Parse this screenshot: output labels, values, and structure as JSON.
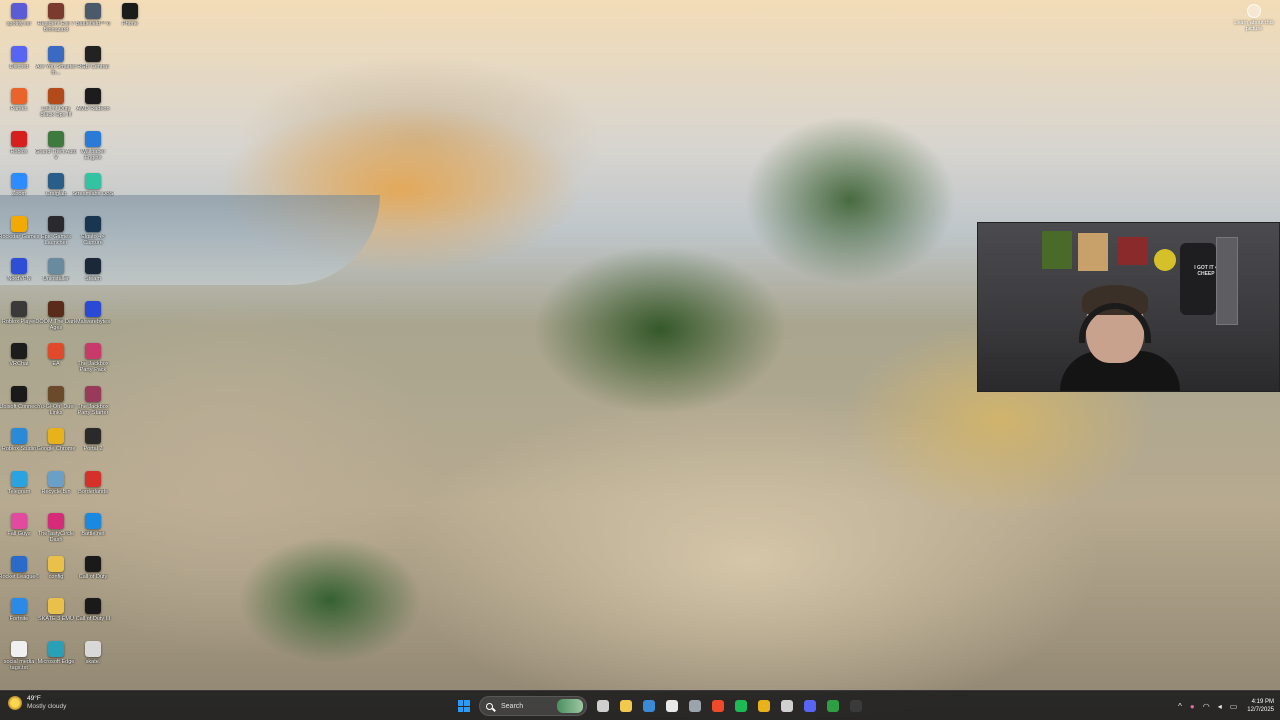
{
  "desktop": {
    "icons": [
      {
        "label": "spotify.ver",
        "icon": "spotify-icon",
        "color": "#5b5bd6"
      },
      {
        "label": "Resident Evil 7 Biohazard",
        "icon": "resident-evil-icon",
        "color": "#7a3b2e"
      },
      {
        "label": "Battlefield™ 6",
        "icon": "battlefield-icon",
        "color": "#4a5a6a"
      },
      {
        "label": "Phone",
        "icon": "phone-icon",
        "color": "#1b1b1b"
      },
      {
        "label": "Discord",
        "icon": "discord-icon",
        "color": "#5865f2"
      },
      {
        "label": "Are You Smarter th...",
        "icon": "game-icon",
        "color": "#3a6ac2"
      },
      {
        "label": "RGB Central",
        "icon": "rgb-icon",
        "color": "#222222"
      },
      {
        "label": "Parsec",
        "icon": "parsec-icon",
        "color": "#e9642b"
      },
      {
        "label": "Call of Duty Black Ops III",
        "icon": "cod-icon",
        "color": "#b34a1a"
      },
      {
        "label": "AMD Radeon",
        "icon": "amd-icon",
        "color": "#1c1c1c"
      },
      {
        "label": "Roblox",
        "icon": "roblox-icon",
        "color": "#d62020"
      },
      {
        "label": "Grand Theft Auto V",
        "icon": "gta-icon",
        "color": "#3e7a3e"
      },
      {
        "label": "Wallpaper Engine",
        "icon": "wallpaper-engine-icon",
        "color": "#2a7ad6"
      },
      {
        "label": "Zoom",
        "icon": "zoom-icon",
        "color": "#2d8cff"
      },
      {
        "label": "Craiglab",
        "icon": "craiglab-icon",
        "color": "#2a5e8a"
      },
      {
        "label": "Streamlabs OBS",
        "icon": "streamlabs-icon",
        "color": "#31c3a2"
      },
      {
        "label": "Rockstar Games",
        "icon": "rockstar-icon",
        "color": "#f2a900"
      },
      {
        "label": "Epic Games Launcher",
        "icon": "epic-icon",
        "color": "#2a2a2a"
      },
      {
        "label": "Elgato 4K Capture",
        "icon": "elgato-icon",
        "color": "#1a3550"
      },
      {
        "label": "NordVPN",
        "icon": "nordvpn-icon",
        "color": "#2e4ed6"
      },
      {
        "label": "Uninstaller",
        "icon": "uninstaller-icon",
        "color": "#6a8aa0"
      },
      {
        "label": "Steam",
        "icon": "steam-icon",
        "color": "#1b2838"
      },
      {
        "label": "Roblox Player",
        "icon": "roblox-player-icon",
        "color": "#3a3a3a"
      },
      {
        "label": "DOOM The Dark Ages",
        "icon": "doom-icon",
        "color": "#5a2a1a"
      },
      {
        "label": "Malwarebytes",
        "icon": "malwarebytes-icon",
        "color": "#2a4ad6"
      },
      {
        "label": "VRChat",
        "icon": "vrchat-icon",
        "color": "#1c1c1c"
      },
      {
        "label": "EA",
        "icon": "ea-icon",
        "color": "#e04a2a"
      },
      {
        "label": "The Jackbox Party Pack",
        "icon": "jackbox-icon",
        "color": "#c83a6a"
      },
      {
        "label": "Ubisoft Connect",
        "icon": "ubisoft-icon",
        "color": "#1a1a1a"
      },
      {
        "label": "Yu-Gi-Oh! Duel Links",
        "icon": "yugioh-icon",
        "color": "#6a4a2a"
      },
      {
        "label": "The Jackbox Party Starter",
        "icon": "jackbox-starter-icon",
        "color": "#9a3a5a"
      },
      {
        "label": "Roblox Studio",
        "icon": "roblox-studio-icon",
        "color": "#2a8ad6"
      },
      {
        "label": "Google Chrome",
        "icon": "chrome-icon",
        "color": "#e8b21a"
      },
      {
        "label": "Portal 2",
        "icon": "portal-icon",
        "color": "#2a2a2a"
      },
      {
        "label": "Telegram",
        "icon": "telegram-icon",
        "color": "#2aa3e0"
      },
      {
        "label": "Recycle Bin",
        "icon": "recycle-bin-icon",
        "color": "#6aa0c8"
      },
      {
        "label": "Borderlands",
        "icon": "borderlands-icon",
        "color": "#d6302a"
      },
      {
        "label": "Fall Guys",
        "icon": "fall-guys-icon",
        "color": "#e24aa0"
      },
      {
        "label": "TheTastyCircle Dash",
        "icon": "tasty-circle-icon",
        "color": "#d62a7a"
      },
      {
        "label": "Battle.net",
        "icon": "battlenet-icon",
        "color": "#1a8ae0"
      },
      {
        "label": "Rocket League®",
        "icon": "rocket-league-icon",
        "color": "#2a6ac8"
      },
      {
        "label": "config",
        "icon": "folder-icon",
        "color": "#e8c04a"
      },
      {
        "label": "Call of Duty",
        "icon": "cod-icon",
        "color": "#1a1a1a"
      },
      {
        "label": "Fortnite",
        "icon": "fortnite-icon",
        "color": "#2a8ae8"
      },
      {
        "label": "SKATE 3 EMU",
        "icon": "folder-icon",
        "color": "#e8c04a"
      },
      {
        "label": "Call of Duty III",
        "icon": "cod-icon",
        "color": "#1a1a1a"
      },
      {
        "label": "social media tags.txt",
        "icon": "text-file-icon",
        "color": "#f0f0f0"
      },
      {
        "label": "Microsoft Edge",
        "icon": "edge-icon",
        "color": "#2aa0b8"
      },
      {
        "label": "skate.",
        "icon": "skate-icon",
        "color": "#d8d8d8"
      }
    ]
  },
  "learn_more": {
    "label": "Learn about this picture",
    "icon": "camera-icon"
  },
  "webcam": {
    "shirt_text": "I GOT IT 4 CHEEP"
  },
  "taskbar": {
    "weather": {
      "temp": "49°F",
      "condition": "Mostly cloudy",
      "icon": "partly-cloudy-icon"
    },
    "search_label": "Search",
    "pinned": [
      {
        "name": "task-view-icon",
        "color": "#cfcfcf"
      },
      {
        "name": "file-explorer-icon",
        "color": "#f2c94c"
      },
      {
        "name": "steam-icon",
        "color": "#3a8ad6"
      },
      {
        "name": "mail-icon",
        "color": "#e8e8e8"
      },
      {
        "name": "settings-icon",
        "color": "#9aa4ad"
      },
      {
        "name": "brave-icon",
        "color": "#f04a2a"
      },
      {
        "name": "spotify-icon",
        "color": "#1db954"
      },
      {
        "name": "chrome-icon",
        "color": "#e8b21a"
      },
      {
        "name": "obs-icon",
        "color": "#d0d0d0"
      },
      {
        "name": "discord-icon",
        "color": "#5865f2"
      },
      {
        "name": "xbox-icon",
        "color": "#2ea043"
      },
      {
        "name": "terminal-icon",
        "color": "#3a3a3a"
      }
    ],
    "tray": {
      "chevron": "^",
      "time": "4:19 PM",
      "date": "12/7/2025"
    }
  }
}
